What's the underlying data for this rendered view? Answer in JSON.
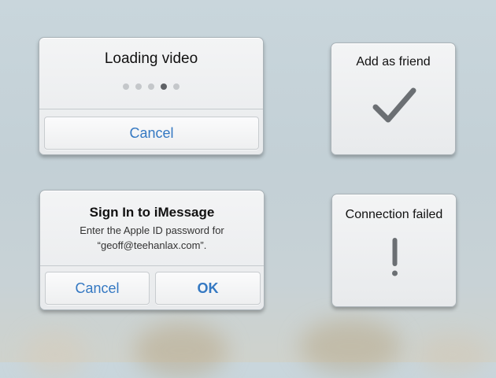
{
  "loading_alert": {
    "title": "Loading video",
    "dot_count": 5,
    "active_dot": 4,
    "cancel_label": "Cancel"
  },
  "friend_hud": {
    "title": "Add as friend",
    "icon": "checkmark-icon"
  },
  "signin_alert": {
    "title": "Sign In to iMessage",
    "message_line1": "Enter the Apple ID password for",
    "message_line2": "“geoff@teehanlax.com”.",
    "cancel_label": "Cancel",
    "ok_label": "OK"
  },
  "connection_hud": {
    "title": "Connection failed",
    "icon": "exclamation-icon"
  },
  "colors": {
    "button_text": "#3478c2",
    "icon": "#6b6f73",
    "dot_active": "#5e6165",
    "dot_inactive": "#c4c7ca"
  }
}
